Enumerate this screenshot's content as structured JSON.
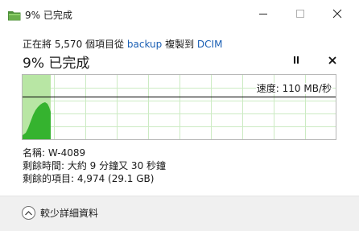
{
  "window": {
    "title": "9% 已完成",
    "icon": "folder-copy-icon",
    "controls": [
      "minimize",
      "maximize",
      "close"
    ]
  },
  "status": {
    "prefix": "正在將",
    "item_count": "5,570",
    "middle": "個項目從",
    "source": "backup",
    "copy_to": "複製到",
    "destination": "DCIM"
  },
  "progress": {
    "headline": "9% 已完成",
    "percent": 9,
    "speed_label": "速度: 110 MB/秒",
    "pause_icon": "pause-icon",
    "cancel_icon": "close-icon",
    "colors": {
      "fill_light": "#b8e6a4",
      "fill_dark": "#35b32f",
      "grid": "#ccebc3",
      "speed_line": "#000000"
    }
  },
  "details": {
    "name": "名稱: W-4089",
    "time_remaining": "剩餘時間: 大約 9 分鐘又 30 秒鐘",
    "items_remaining": "剩餘的項目: 4,974 (29.1 GB)"
  },
  "footer": {
    "more_details": "較少詳細資料",
    "chevron_icon": "chevron-up-icon"
  }
}
